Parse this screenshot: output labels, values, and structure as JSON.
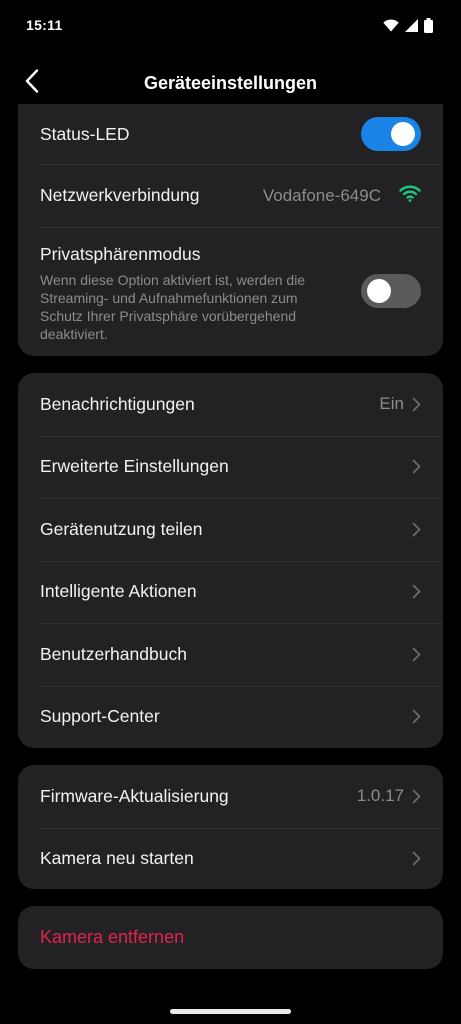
{
  "status_bar": {
    "time": "15:11",
    "icons": [
      "wifi-icon",
      "signal-icon",
      "battery-icon"
    ]
  },
  "header": {
    "title": "Geräteeinstellungen",
    "back_icon": "chevron-left-icon"
  },
  "device_section": {
    "status_led": {
      "label": "Status-LED",
      "enabled": true
    },
    "network": {
      "label": "Netzwerkverbindung",
      "value": "Vodafone-649C",
      "icon": "wifi-icon",
      "icon_color": "#1fc77a"
    },
    "privacy": {
      "label": "Privatsphärenmodus",
      "description": "Wenn diese Option aktiviert ist, werden die Streaming- und Aufnahmefunktionen zum Schutz Ihrer Privatsphäre vorübergehend deaktiviert.",
      "enabled": false
    }
  },
  "settings_section": {
    "items": [
      {
        "label": "Benachrichtigungen",
        "value": "Ein"
      },
      {
        "label": "Erweiterte Einstellungen",
        "value": ""
      },
      {
        "label": "Gerätenutzung teilen",
        "value": ""
      },
      {
        "label": "Intelligente Aktionen",
        "value": ""
      },
      {
        "label": "Benutzerhandbuch",
        "value": ""
      },
      {
        "label": "Support-Center",
        "value": ""
      }
    ]
  },
  "firmware_section": {
    "items": [
      {
        "label": "Firmware-Aktualisierung",
        "value": "1.0.17"
      },
      {
        "label": "Kamera neu starten",
        "value": ""
      }
    ]
  },
  "danger_section": {
    "remove_label": "Kamera entfernen",
    "color": "#e0244e"
  },
  "colors": {
    "background": "#000000",
    "card": "#222224",
    "toggle_on": "#1a84e6",
    "toggle_off": "#5a5a5d",
    "secondary_text": "#8c8c8f"
  }
}
